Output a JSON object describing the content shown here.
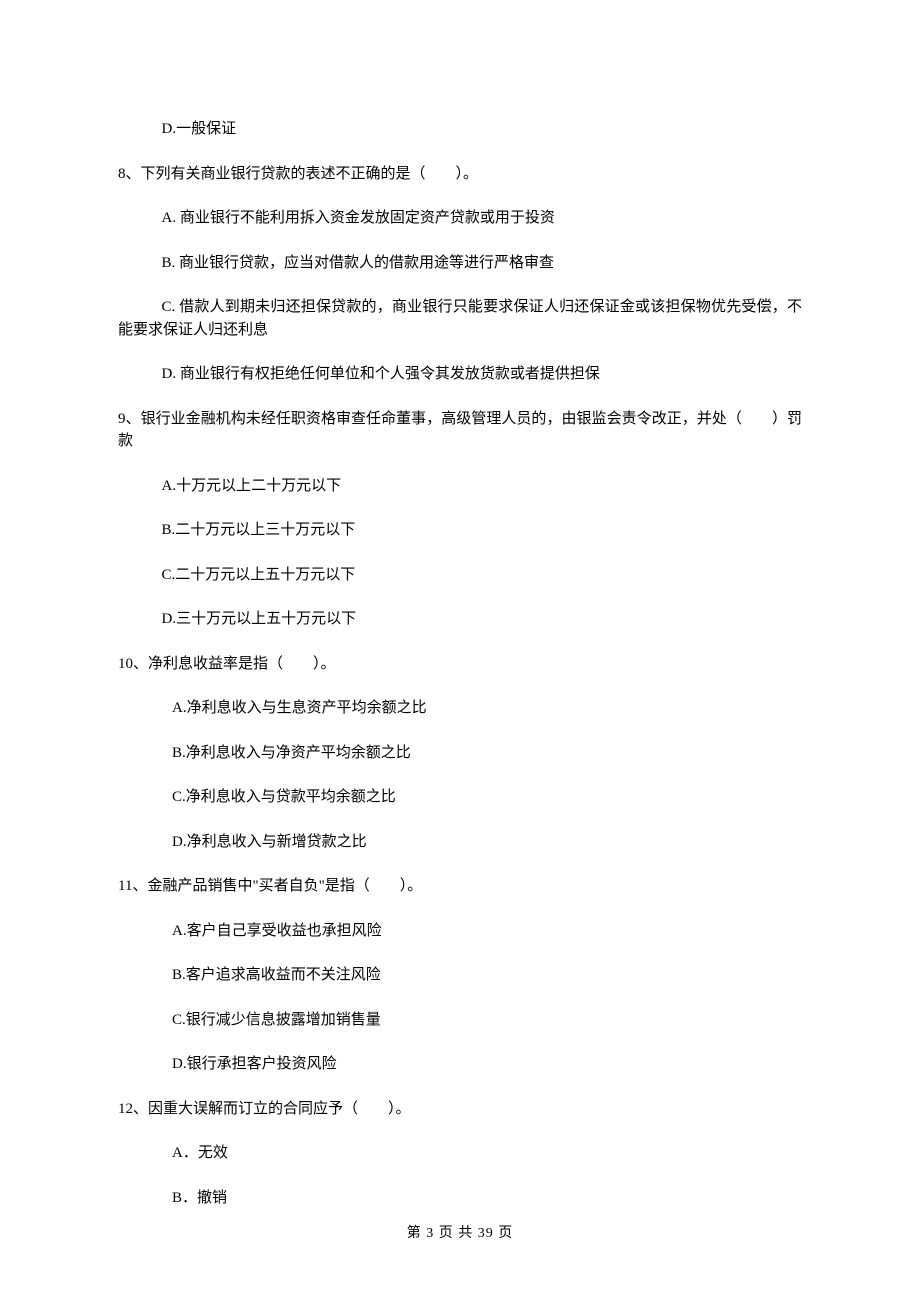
{
  "q7_d": "D.一般保证",
  "q8": "8、下列有关商业银行贷款的表述不正确的是（　　）。",
  "q8_a": "A.  商业银行不能利用拆入资金发放固定资产贷款或用于投资",
  "q8_b": "B.  商业银行贷款，应当对借款人的借款用途等进行严格审查",
  "q8_c": "C.  借款人到期未归还担保贷款的，商业银行只能要求保证人归还保证金或该担保物优先受偿，不能要求保证人归还利息",
  "q8_d": "D.  商业银行有权拒绝任何单位和个人强令其发放货款或者提供担保",
  "q9": "9、银行业金融机构未经任职资格审查任命董事，高级管理人员的，由银监会责令改正，并处（　　）罚款",
  "q9_a": "A.十万元以上二十万元以下",
  "q9_b": "B.二十万元以上三十万元以下",
  "q9_c": "C.二十万元以上五十万元以下",
  "q9_d": "D.三十万元以上五十万元以下",
  "q10": "10、净利息收益率是指（　　）。",
  "q10_a": "A.净利息收入与生息资产平均余额之比",
  "q10_b": "B.净利息收入与净资产平均余额之比",
  "q10_c": "C.净利息收入与贷款平均余额之比",
  "q10_d": "D.净利息收入与新增贷款之比",
  "q11": "11、金融产品销售中\"买者自负\"是指（　　）。",
  "q11_a": "A.客户自己享受收益也承担风险",
  "q11_b": "B.客户追求高收益而不关注风险",
  "q11_c": "C.银行减少信息披露增加销售量",
  "q11_d": "D.银行承担客户投资风险",
  "q12": "12、因重大误解而订立的合同应予（　　）。",
  "q12_a": "A．无效",
  "q12_b": "B．撤销",
  "footer": "第 3 页 共 39 页"
}
